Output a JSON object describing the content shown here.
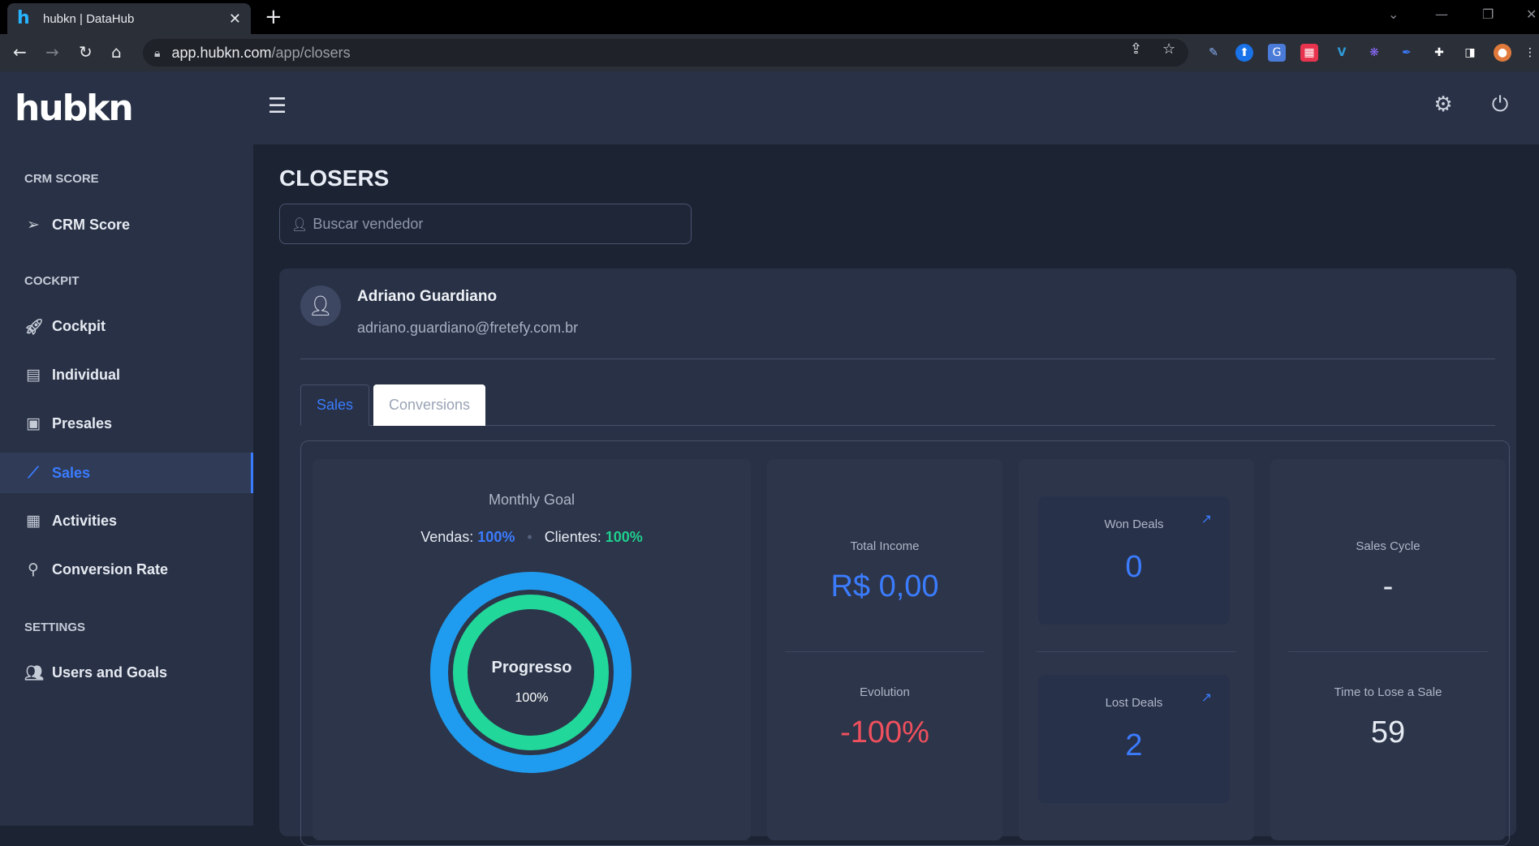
{
  "browser": {
    "tab_title": "hubkn | DataHub",
    "favicon": "h",
    "url_host": "app.hubkn.com",
    "url_path": "/app/closers"
  },
  "app": {
    "logo": "hubkn",
    "accent_color": "#3b7cff",
    "success_color": "#1fcf8e",
    "danger_color": "#f0505e"
  },
  "sidebar": {
    "sections": [
      {
        "title": "CRM SCORE",
        "items": [
          {
            "label": "CRM Score",
            "icon": "send-icon"
          }
        ]
      },
      {
        "title": "COCKPIT",
        "items": [
          {
            "label": "Cockpit",
            "icon": "rocket-icon"
          },
          {
            "label": "Individual",
            "icon": "report-icon"
          },
          {
            "label": "Presales",
            "icon": "presentation-icon"
          },
          {
            "label": "Sales",
            "icon": "chart-line-icon",
            "active": true
          },
          {
            "label": "Activities",
            "icon": "calendar-check-icon"
          },
          {
            "label": "Conversion Rate",
            "icon": "search-icon"
          }
        ]
      },
      {
        "title": "SETTINGS",
        "items": [
          {
            "label": "Users and Goals",
            "icon": "users-icon"
          }
        ]
      }
    ]
  },
  "main": {
    "title": "CLOSERS",
    "search_placeholder": "Buscar vendedor",
    "user": {
      "name": "Adriano Guardiano",
      "email": "adriano.guardiano@fretefy.com.br"
    },
    "tabs": [
      {
        "label": "Sales",
        "active": true
      },
      {
        "label": "Conversions",
        "active": false
      }
    ],
    "goal": {
      "title": "Monthly Goal",
      "vendas_label": "Vendas:",
      "vendas_value": "100%",
      "clientes_label": "Clientes:",
      "clientes_value": "100%",
      "ring_label": "Progresso",
      "ring_value": "100%",
      "outer_progress": 1.0,
      "inner_progress": 1.0
    },
    "metrics": {
      "total_income_label": "Total Income",
      "total_income_value": "R$ 0,00",
      "evolution_label": "Evolution",
      "evolution_value": "-100%",
      "won_deals_label": "Won Deals",
      "won_deals_value": "0",
      "lost_deals_label": "Lost Deals",
      "lost_deals_value": "2",
      "sales_cycle_label": "Sales Cycle",
      "sales_cycle_value": "-",
      "time_to_lose_label": "Time to Lose a Sale",
      "time_to_lose_value": "59"
    }
  }
}
